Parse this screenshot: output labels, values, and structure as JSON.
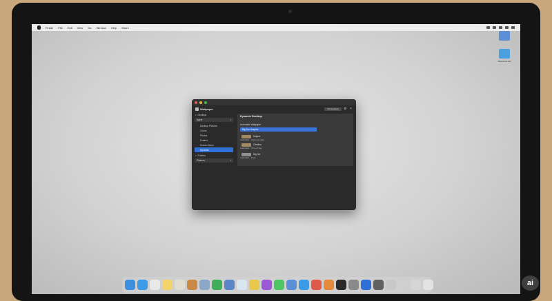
{
  "menubar": {
    "items": [
      "Finder",
      "File",
      "Edit",
      "View",
      "Go",
      "Window",
      "Help",
      "Share"
    ],
    "status_icons": [
      "wifi-icon",
      "battery-icon",
      "control-center-icon",
      "search-icon",
      "clock-icon"
    ]
  },
  "desktop_icons": [
    {
      "label": "",
      "icon": "file-icon",
      "color": "#5b8fd6"
    },
    {
      "label": "Macintosh HD",
      "icon": "folder-icon",
      "color": "#4aa0e0"
    }
  ],
  "window": {
    "title": "Wallpaper",
    "toolbar_button": "Set Desktop",
    "sidebar": {
      "section1": "Desktop",
      "field1": "Apple",
      "items": [
        "Desktop Pictures",
        "Colors",
        "Photos",
        "Folders",
        "Screen Saver",
        "Dynamic"
      ],
      "selected_index": 4,
      "section2": "Folders",
      "field2": "Pictures"
    },
    "main": {
      "title": "Dynamic Desktop",
      "subtitle": "Automatic Wallpaper",
      "highlighted": "Big Sur Graphic",
      "rows": [
        {
          "label": "Mojave",
          "caption": "Automatic · Light and dark"
        },
        {
          "label": "Catalina",
          "caption": "Automatic · Time of day"
        },
        {
          "label": "Big Sur",
          "caption": "Automatic · Dark"
        }
      ]
    }
  },
  "dock": {
    "apps": [
      {
        "icon": "finder-icon",
        "color": "#3d8fe0"
      },
      {
        "icon": "safari-icon",
        "color": "#3a9be8"
      },
      {
        "icon": "chrome-icon",
        "color": "#e9e9e9"
      },
      {
        "icon": "notes-icon",
        "color": "#f2d46b"
      },
      {
        "icon": "documents-icon",
        "color": "#e0dccf"
      },
      {
        "icon": "photos-icon",
        "color": "#c98a47"
      },
      {
        "icon": "folder-icon",
        "color": "#8aa7c7"
      },
      {
        "icon": "numbers-icon",
        "color": "#3fae5a"
      },
      {
        "icon": "keynote-icon",
        "color": "#5a86c7"
      },
      {
        "icon": "maps-icon",
        "color": "#d8e6f0"
      },
      {
        "icon": "stickies-icon",
        "color": "#e8c84a"
      },
      {
        "icon": "podcasts-icon",
        "color": "#9b59d6"
      },
      {
        "icon": "messages-icon",
        "color": "#4cc764"
      },
      {
        "icon": "system-icon",
        "color": "#5b8fd6"
      },
      {
        "icon": "app-store-icon",
        "color": "#3a9be8"
      },
      {
        "icon": "photo-booth-icon",
        "color": "#e05a4a"
      },
      {
        "icon": "camera-icon",
        "color": "#e58a3a"
      },
      {
        "icon": "launchpad-icon",
        "color": "#2a2a2a"
      },
      {
        "icon": "settings-icon",
        "color": "#8a8a8a"
      },
      {
        "icon": "globe-icon",
        "color": "#2f6fd6"
      },
      {
        "icon": "lock-icon",
        "color": "#606060"
      },
      {
        "icon": "tools-icon",
        "color": "#c8c8c8"
      },
      {
        "icon": "folder-icon",
        "color": "#cfcfcf"
      },
      {
        "icon": "downloads-icon",
        "color": "#d5d5d5"
      },
      {
        "icon": "trash-icon",
        "color": "#e3e3e3"
      }
    ]
  },
  "badge": "ai"
}
